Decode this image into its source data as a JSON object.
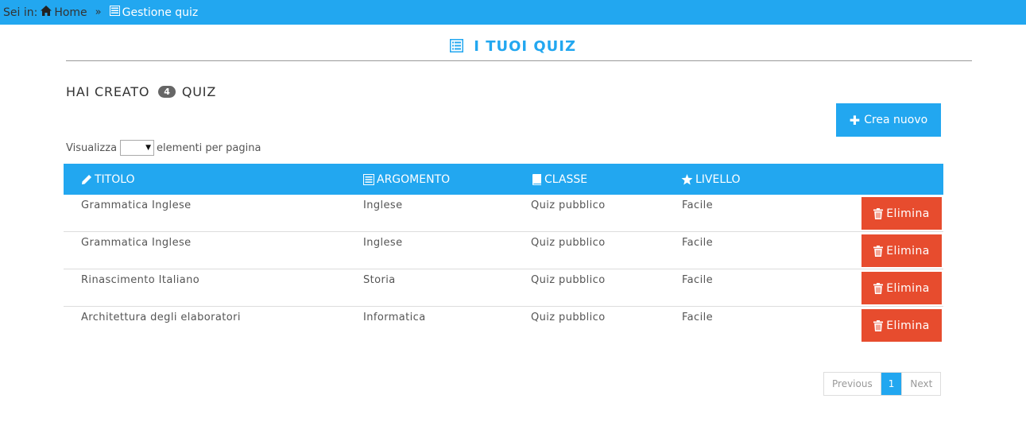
{
  "breadcrumb": {
    "prefix": "Sei in:",
    "home": "Home",
    "separator": "»",
    "current": "Gestione quiz",
    "home_icon": "home-icon",
    "current_icon": "list-icon"
  },
  "heading": {
    "title": "I TUOI QUIZ",
    "icon": "list-icon"
  },
  "summary": {
    "before": "HAI CREATO",
    "count": "4",
    "after": "QUIZ"
  },
  "create_button": {
    "label": "Crea nuovo",
    "icon": "plus-icon"
  },
  "page_length": {
    "before": "Visualizza",
    "selected": "",
    "after": "elementi per pagina"
  },
  "table": {
    "columns": [
      {
        "label": "TITOLO",
        "icon": "pencil-icon"
      },
      {
        "label": "ARGOMENTO",
        "icon": "list-icon"
      },
      {
        "label": "CLASSE",
        "icon": "book-icon"
      },
      {
        "label": "LIVELLO",
        "icon": "star-icon"
      }
    ],
    "rows": [
      {
        "titolo": "Grammatica Inglese",
        "argomento": "Inglese",
        "classe": "Quiz pubblico",
        "livello": "Facile",
        "action": "Elimina"
      },
      {
        "titolo": "Grammatica Inglese",
        "argomento": "Inglese",
        "classe": "Quiz pubblico",
        "livello": "Facile",
        "action": "Elimina"
      },
      {
        "titolo": "Rinascimento Italiano",
        "argomento": "Storia",
        "classe": "Quiz pubblico",
        "livello": "Facile",
        "action": "Elimina"
      },
      {
        "titolo": "Architettura degli elaboratori",
        "argomento": "Informatica",
        "classe": "Quiz pubblico",
        "livello": "Facile",
        "action": "Elimina"
      }
    ]
  },
  "pagination": {
    "previous": "Previous",
    "current": "1",
    "next": "Next"
  },
  "colors": {
    "accent": "#22a7f0",
    "danger": "#e74c2e",
    "badge": "#666666"
  }
}
